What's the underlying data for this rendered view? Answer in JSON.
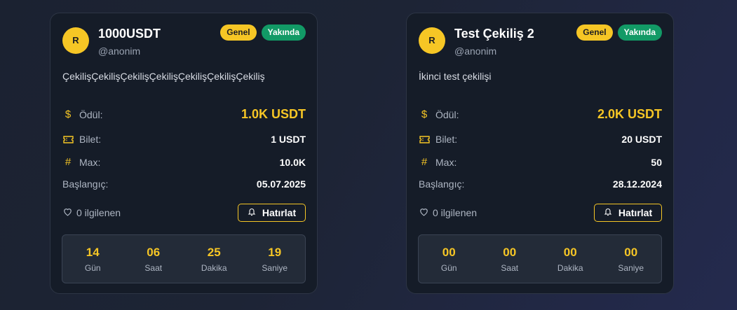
{
  "cards": [
    {
      "avatar": "R",
      "title": "1000USDT",
      "handle": "@anonim",
      "badges": [
        "Genel",
        "Yakında"
      ],
      "description": "ÇekilişÇekilişÇekilişÇekilişÇekilişÇekilişÇekiliş",
      "prize_label": "Ödül:",
      "prize_value": "1.0K USDT",
      "ticket_label": "Bilet:",
      "ticket_value": "1 USDT",
      "max_label": "Max:",
      "max_value": "10.0K",
      "start_label": "Başlangıç:",
      "start_value": "05.07.2025",
      "interest": "0 ilgilenen",
      "remind_label": "Hatırlat",
      "timer": [
        {
          "value": "14",
          "label": "Gün"
        },
        {
          "value": "06",
          "label": "Saat"
        },
        {
          "value": "25",
          "label": "Dakika"
        },
        {
          "value": "19",
          "label": "Saniye"
        }
      ]
    },
    {
      "avatar": "R",
      "title": "Test Çekiliş 2",
      "handle": "@anonim",
      "badges": [
        "Genel",
        "Yakında"
      ],
      "description": "İkinci test çekilişi",
      "prize_label": "Ödül:",
      "prize_value": "2.0K USDT",
      "ticket_label": "Bilet:",
      "ticket_value": "20 USDT",
      "max_label": "Max:",
      "max_value": "50",
      "start_label": "Başlangıç:",
      "start_value": "28.12.2024",
      "interest": "0 ilgilenen",
      "remind_label": "Hatırlat",
      "timer": [
        {
          "value": "00",
          "label": "Gün"
        },
        {
          "value": "00",
          "label": "Saat"
        },
        {
          "value": "00",
          "label": "Dakika"
        },
        {
          "value": "00",
          "label": "Saniye"
        }
      ]
    }
  ],
  "icons": {
    "prize": "dollar-icon",
    "ticket": "ticket-icon",
    "max": "hash-icon",
    "interest": "heart-icon",
    "remind": "bell-icon"
  },
  "colors": {
    "accent": "#f6c625",
    "badge_green": "#129a66",
    "card_bg": "#151c28"
  }
}
